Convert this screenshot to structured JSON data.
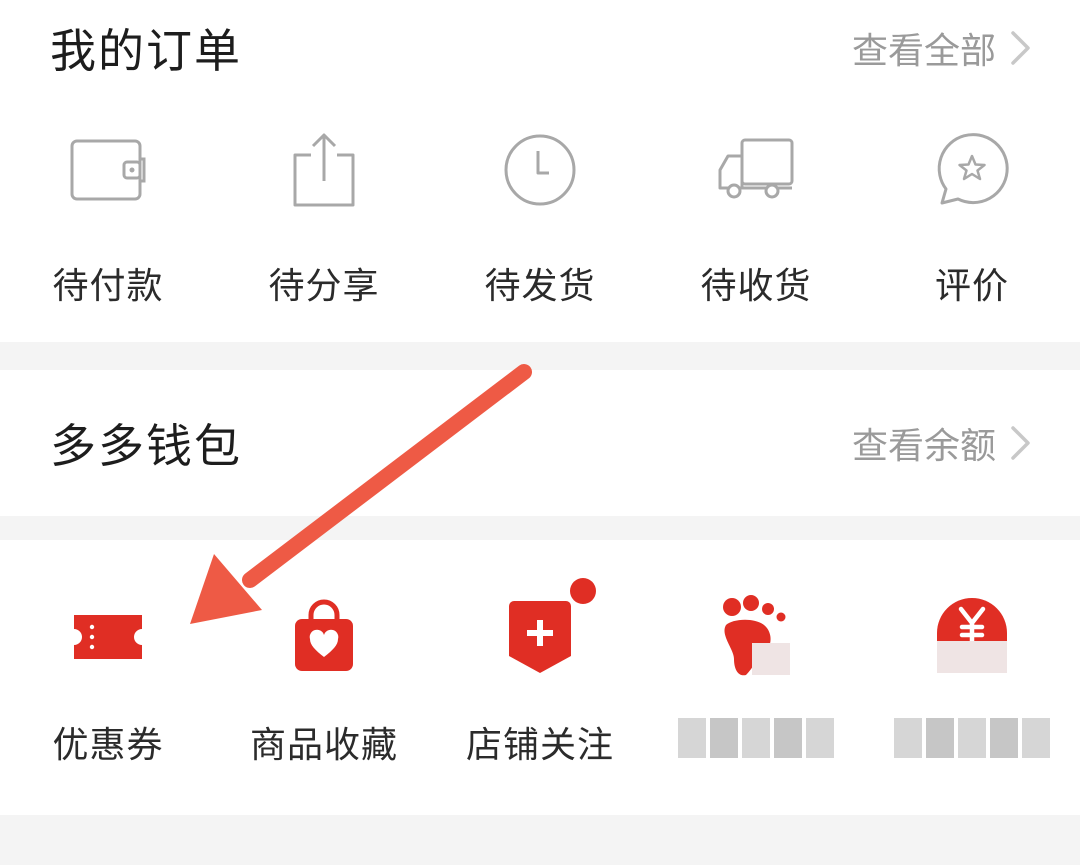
{
  "orders": {
    "title": "我的订单",
    "link": "查看全部",
    "items": [
      {
        "label": "待付款",
        "icon": "wallet-icon"
      },
      {
        "label": "待分享",
        "icon": "share-icon"
      },
      {
        "label": "待发货",
        "icon": "clock-icon"
      },
      {
        "label": "待收货",
        "icon": "truck-icon"
      },
      {
        "label": "评价",
        "icon": "review-star-icon"
      }
    ]
  },
  "wallet": {
    "title": "多多钱包",
    "link": "查看余额"
  },
  "tools": {
    "items": [
      {
        "label": "优惠券",
        "icon": "coupon-icon"
      },
      {
        "label": "商品收藏",
        "icon": "favorite-bag-icon"
      },
      {
        "label": "店铺关注",
        "icon": "store-follow-icon"
      },
      {
        "label": "",
        "icon": "footprint-icon"
      },
      {
        "label": "",
        "icon": "yuan-icon"
      }
    ]
  },
  "colors": {
    "accent_red": "#e02e24",
    "annotation_arrow": "#ee5a45",
    "icon_gray": "#a8a8a8",
    "text_gray": "#9a9a9a"
  }
}
